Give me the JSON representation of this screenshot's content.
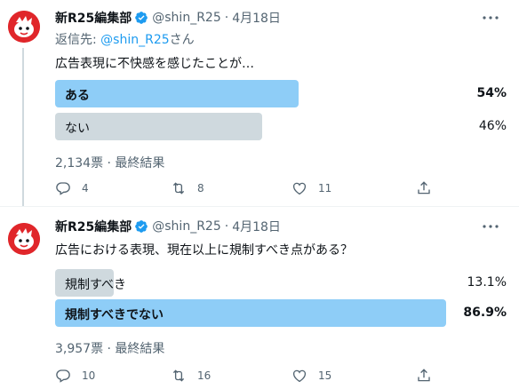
{
  "tweets": [
    {
      "author": {
        "name": "新R25編集部",
        "handle": "@shin_R25",
        "date": "4月18日"
      },
      "reply_to": {
        "prefix": "返信先: ",
        "handle": "@shin_R25",
        "suffix": "さん"
      },
      "text": "広告表現に不快感を感じたことが…",
      "poll": {
        "options": [
          {
            "label": "ある",
            "percent": "54%",
            "fraction": 0.54,
            "winner": true
          },
          {
            "label": "ない",
            "percent": "46%",
            "fraction": 0.46,
            "winner": false
          }
        ],
        "result": "2,134票 · 最終結果"
      },
      "actions": {
        "replies": "4",
        "retweets": "8",
        "likes": "11"
      }
    },
    {
      "author": {
        "name": "新R25編集部",
        "handle": "@shin_R25",
        "date": "4月18日"
      },
      "text": "広告における表現、現在以上に規制すべき点がある？",
      "poll": {
        "options": [
          {
            "label": "規制すべき",
            "percent": "13.1%",
            "fraction": 0.131,
            "winner": false
          },
          {
            "label": "規制すべきでない",
            "percent": "86.9%",
            "fraction": 0.869,
            "winner": true
          }
        ],
        "result": "3,957票 · 最終結果"
      },
      "actions": {
        "replies": "10",
        "retweets": "16",
        "likes": "15"
      }
    }
  ],
  "colors": {
    "accent": "#1d9bf0",
    "poll_winner": "#8ecdf7",
    "poll_other": "#cfd9de",
    "secondary_text": "#536471",
    "avatar": "#e0262a"
  },
  "icons": [
    "reply-icon",
    "retweet-icon",
    "like-icon",
    "share-icon",
    "more-icon",
    "verified-badge-icon"
  ]
}
